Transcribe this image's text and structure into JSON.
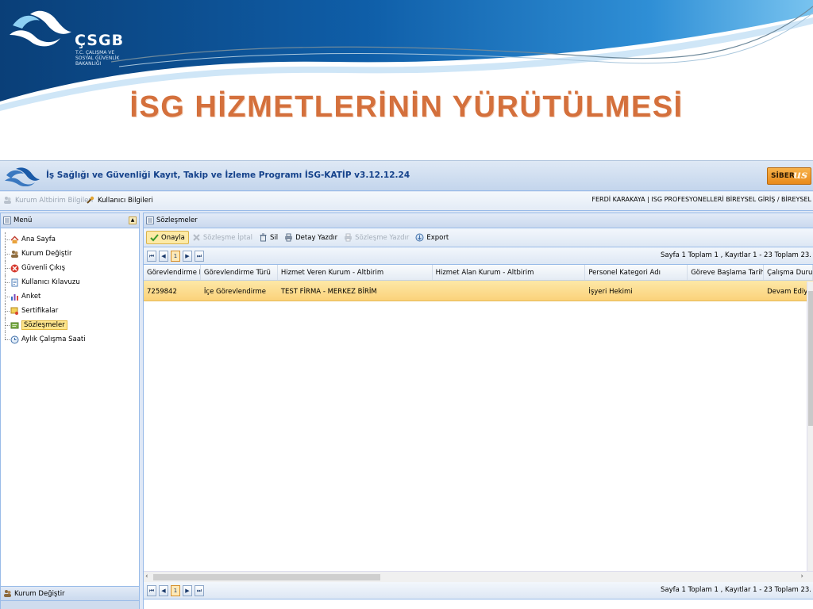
{
  "slide": {
    "logo_word": "ÇSGB",
    "logo_sub": "T.C. ÇALIŞMA VE\nSOSYAL GÜVENLİK\nBAKANLIĞI",
    "title": "İSG HİZMETLERİNİN YÜRÜTÜLMESİ"
  },
  "app": {
    "title": "İş Sağlığı ve Güvenliği Kayıt, Takip ve İzleme Programı İSG-KATİP v3.12.12.24",
    "brand_left": "SİBER",
    "brand_right": "us",
    "user_bar": {
      "kurum_label": "Kurum Altbirim Bilgileri",
      "kullanici_label": "Kullanıcı Bilgileri",
      "user_info": "FERDİ KARAKAYA | ISG PROFESYONELLERİ BİREYSEL GİRİŞ / BİREYSEL"
    },
    "menu": {
      "title": "Menü",
      "items": [
        {
          "label": "Ana Sayfa",
          "icon": "home-icon"
        },
        {
          "label": "Kurum Değiştir",
          "icon": "users-icon"
        },
        {
          "label": "Güvenli Çıkış",
          "icon": "exit-icon"
        },
        {
          "label": "Kullanıcı Kılavuzu",
          "icon": "book-icon"
        },
        {
          "label": "Anket",
          "icon": "chart-icon"
        },
        {
          "label": "Sertifikalar",
          "icon": "certificate-icon"
        },
        {
          "label": "Sözleşmeler",
          "icon": "contract-icon",
          "selected": true
        },
        {
          "label": "Aylık Çalışma Saati",
          "icon": "clock-icon"
        }
      ],
      "bottom_tab": "Kurum Değiştir"
    },
    "content": {
      "title": "Sözleşmeler",
      "toolbar": {
        "onayla": "Onayla",
        "iptal": "Sözleşme İptal",
        "sil": "Sil",
        "detay": "Detay Yazdır",
        "yazdir": "Sözleşme Yazdır",
        "export": "Export"
      },
      "pager": {
        "first": "⏮",
        "prev": "◀",
        "page": "1",
        "next": "▶",
        "last": "⏭",
        "info": "Sayfa 1 Toplam 1 , Kayıtlar 1 - 23 Toplam 23.",
        "info_bottom": "Sayfa 1 Toplam 1 , Kayıtlar 1 - 23 Toplam 23."
      },
      "columns": [
        "Görevlendirme ID",
        "Görevlendirme Türü",
        "Hizmet Veren Kurum - Altbirim",
        "Hizmet Alan Kurum - Altbirim",
        "Personel Kategori Adı",
        "Göreve Başlama Tarihi",
        "Çalışma Durum"
      ],
      "rows": [
        [
          "7259842",
          "İçe Görevlendirme",
          "TEST FİRMA - MERKEZ BİRİM",
          "",
          "İşyeri Hekimi",
          "",
          "Devam Ediyor"
        ]
      ]
    }
  },
  "colors": {
    "title_orange": "#d4703c",
    "banner_blue": "#0b4a86",
    "selection_yellow": "#fbd27a",
    "panel_border": "#99bbe8"
  }
}
